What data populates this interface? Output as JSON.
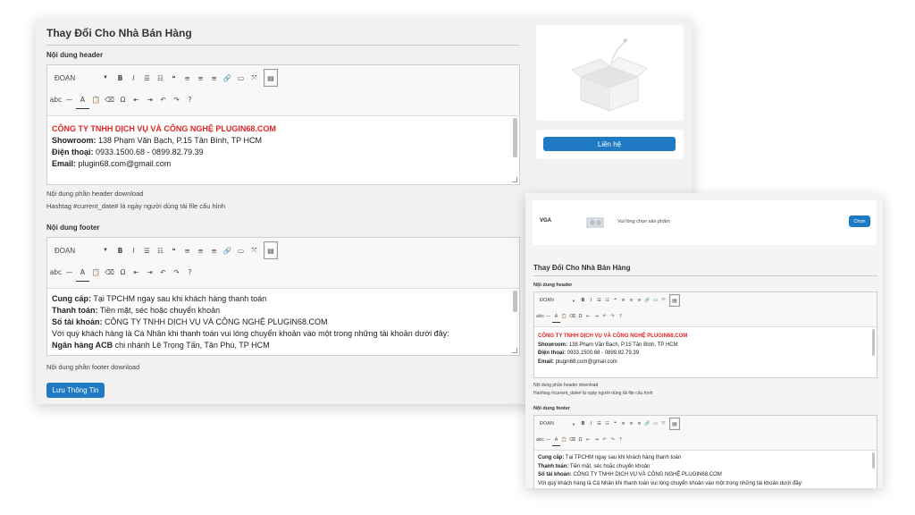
{
  "main": {
    "title": "Thay Đổi Cho Nhà Bán Hàng",
    "header_label": "Nội dung header",
    "footer_label": "Nội dung footer",
    "format_select": "ĐOẠN",
    "header_lines": [
      {
        "bold": "CÔNG TY TNHH DỊCH VỤ VÀ CÔNG NGHỆ PLUGIN68.COM",
        "rest": ""
      },
      {
        "bold": "Showroom:",
        "rest": " 138 Phạm Văn Bạch, P.15 Tân Bình, TP HCM"
      },
      {
        "bold": "Điện thoại:",
        "rest": " 0933.1500.68 - 0899.82.79.39"
      },
      {
        "bold": "Email:",
        "rest": " plugin68.com@gmail.com"
      }
    ],
    "header_note1": "Nội dung phần header download",
    "header_note2": "Hashtag #current_date# là ngày người dùng tải file cấu hình",
    "footer_lines": [
      {
        "bold": "Cung cấp:",
        "rest": " Tại TPCHM ngay sau khi khách hàng thanh toán"
      },
      {
        "bold": "Thanh toán:",
        "rest": " Tiền mặt, séc hoặc chuyển khoản"
      },
      {
        "bold": "Số tài khoản:",
        "rest": " CÔNG TY TNHH DỊCH VỤ VÀ CÔNG NGHỆ PLUGIN68.COM"
      },
      {
        "bold": "",
        "rest": "Với quý khách hàng là Cá Nhân khi thanh toán vui lòng chuyển khoản vào một trong những tài khoản dưới đây:"
      },
      {
        "bold": "Ngân hàng ACB",
        "rest": " chi nhánh Lê Trọng Tấn, Tân Phú, TP HCM"
      }
    ],
    "footer_note": "Nội dung phần footer download",
    "save_button": "Lưu Thông Tin"
  },
  "product_card": {
    "contact_button": "Liên hệ"
  },
  "second_panel": {
    "vga_label": "VGA",
    "vga_placeholder": "Vui lòng chọn sản phẩm",
    "choose_button": "Chọn",
    "title": "Thay Đổi Cho Nhà Bán Hàng",
    "header_label": "Nội dung header",
    "footer_label": "Nội dung footer",
    "format_select": "ĐOẠN",
    "header_lines": [
      {
        "bold": "CÔNG TY TNHH DỊCH VỤ VÀ CÔNG NGHỆ PLUGIN68.COM",
        "rest": ""
      },
      {
        "bold": "Showroom:",
        "rest": " 138 Phạm Văn Bạch, P.15 Tân Bình, TP HCM"
      },
      {
        "bold": "Điện thoại:",
        "rest": " 0933.1500.68 - 0899.82.79.39"
      },
      {
        "bold": "Email:",
        "rest": " plugin68.com@gmail.com"
      }
    ],
    "header_note1": "Nội dung phần header download",
    "header_note2": "Hashtag #current_date# là ngày người dùng tải file cấu hình",
    "footer_lines": [
      {
        "bold": "Cung cấp:",
        "rest": " Tại TPCHM ngay sau khi khách hàng thanh toán"
      },
      {
        "bold": "Thanh toán:",
        "rest": " Tiền mặt, séc hoặc chuyển khoản"
      },
      {
        "bold": "Số tài khoản:",
        "rest": " CÔNG TY TNHH DỊCH VỤ VÀ CÔNG NGHỆ PLUGIN68.COM"
      },
      {
        "bold": "",
        "rest": "Với quý khách hàng là Cá Nhân khi thanh toán vui lòng chuyển khoản vào một trong những tài khoản dưới đây:"
      }
    ]
  },
  "toolbar_row1": [
    {
      "name": "bold-icon",
      "glyph": "B"
    },
    {
      "name": "italic-icon",
      "glyph": "I"
    },
    {
      "name": "bullet-list-icon",
      "glyph": "☰"
    },
    {
      "name": "numbered-list-icon",
      "glyph": "☷"
    },
    {
      "name": "blockquote-icon",
      "glyph": "❝"
    },
    {
      "name": "align-left-icon",
      "glyph": "≡"
    },
    {
      "name": "align-center-icon",
      "glyph": "≡"
    },
    {
      "name": "align-right-icon",
      "glyph": "≡"
    },
    {
      "name": "link-icon",
      "glyph": "🔗"
    },
    {
      "name": "read-more-icon",
      "glyph": "▭"
    },
    {
      "name": "fullscreen-icon",
      "glyph": "⤧"
    }
  ],
  "toolbar_row2": [
    {
      "name": "strikethrough-icon",
      "glyph": "abc"
    },
    {
      "name": "horizontal-line-icon",
      "glyph": "—"
    },
    {
      "name": "text-color-icon",
      "glyph": "A"
    },
    {
      "name": "paste-text-icon",
      "glyph": "📋"
    },
    {
      "name": "clear-format-icon",
      "glyph": "⌫"
    },
    {
      "name": "special-char-icon",
      "glyph": "Ω"
    },
    {
      "name": "outdent-icon",
      "glyph": "⇤"
    },
    {
      "name": "indent-icon",
      "glyph": "⇥"
    },
    {
      "name": "undo-icon",
      "glyph": "↶"
    },
    {
      "name": "redo-icon",
      "glyph": "↷"
    },
    {
      "name": "help-icon",
      "glyph": "?"
    }
  ],
  "colors": {
    "accent": "#1f7ac3",
    "highlight": "#e02424",
    "panel": "#f1f1f1"
  }
}
